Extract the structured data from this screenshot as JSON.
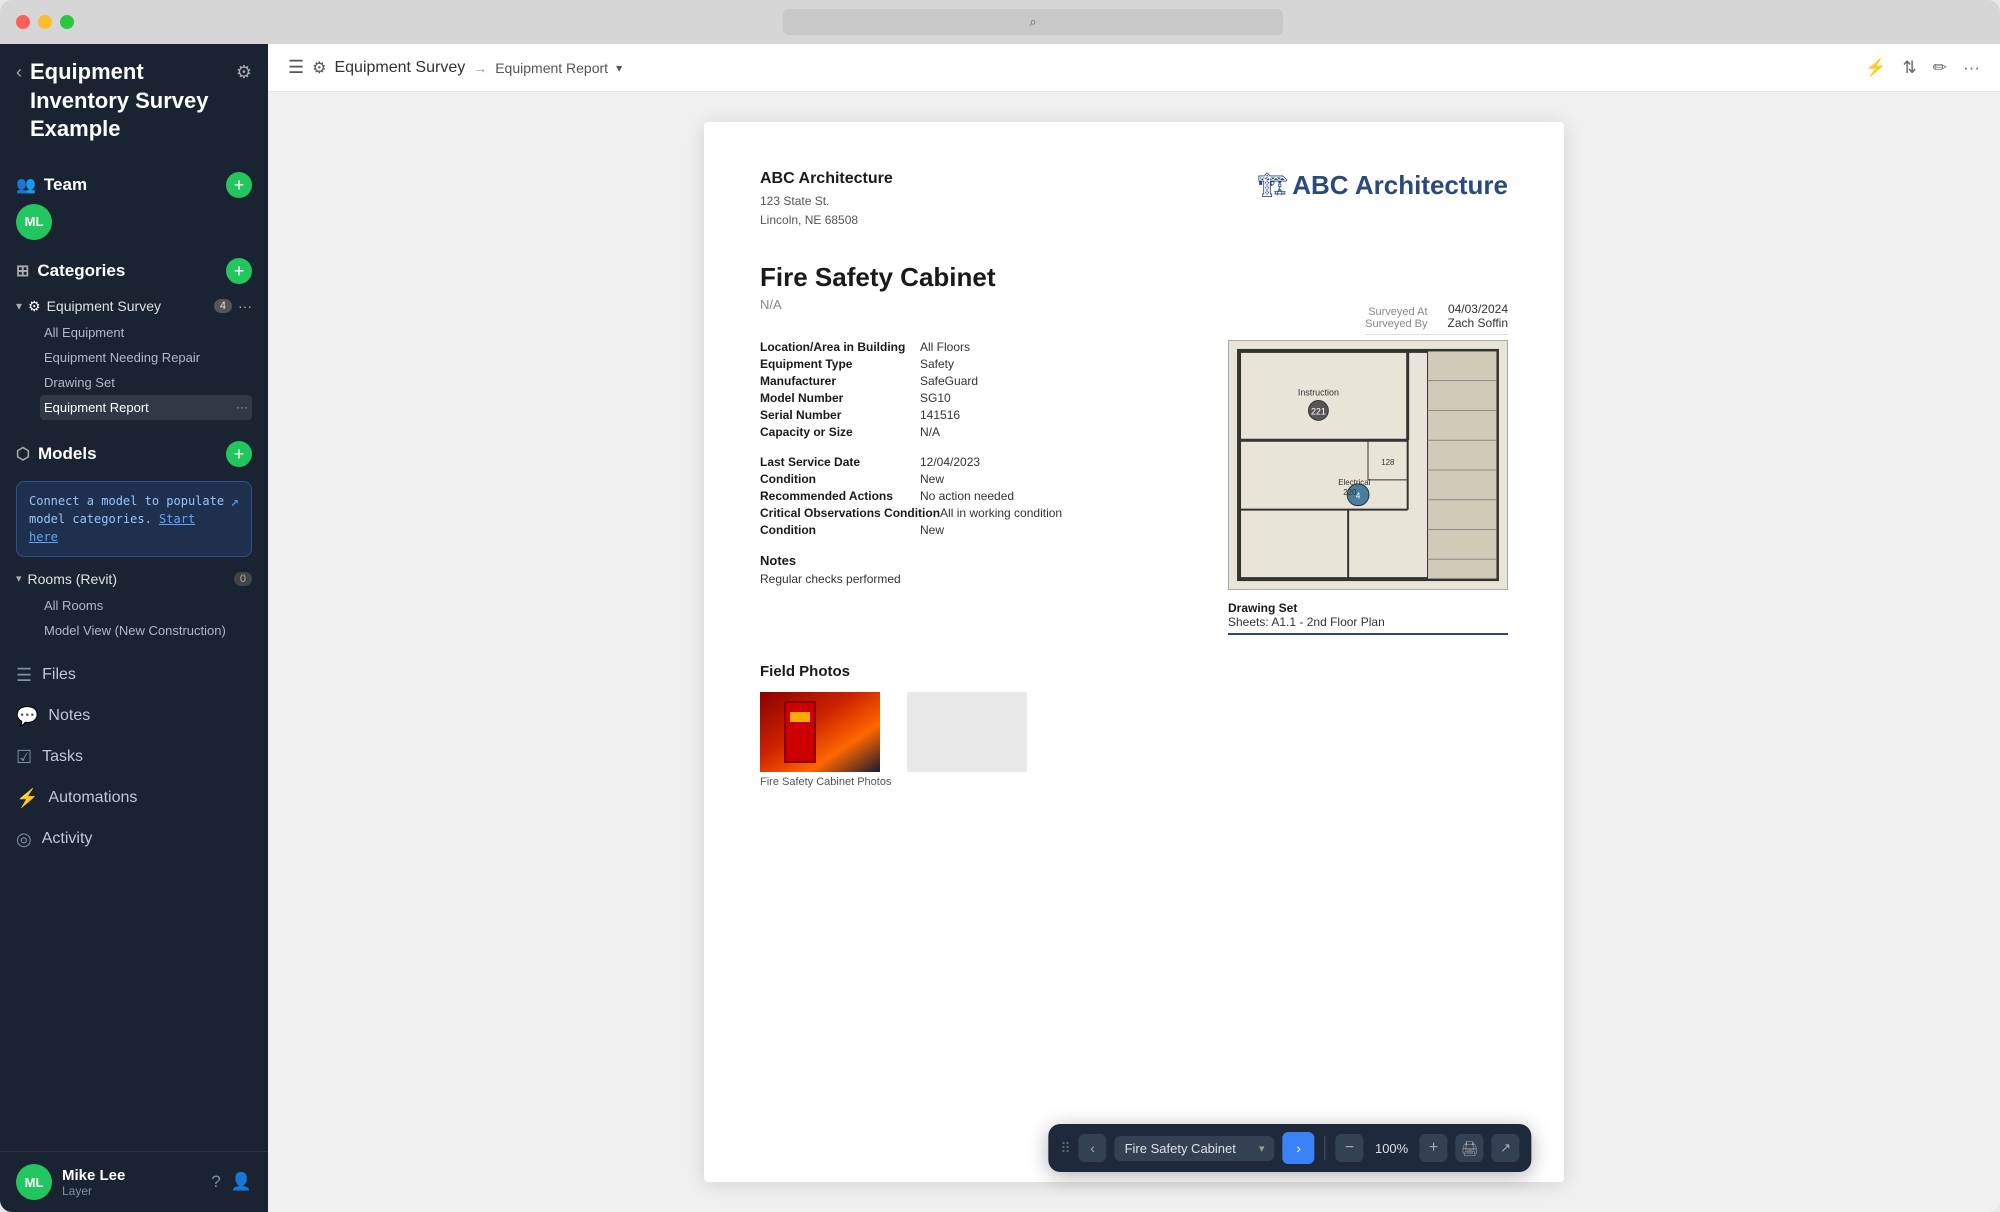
{
  "window": {
    "title": "Equipment Inventory Survey Example"
  },
  "sidebar": {
    "title": "Equipment Inventory Survey Example",
    "team_label": "Team",
    "categories_label": "Categories",
    "models_label": "Models",
    "files_label": "Files",
    "notes_label": "Notes",
    "tasks_label": "Tasks",
    "automations_label": "Automations",
    "activity_label": "Activity",
    "user_name": "Mike Lee",
    "user_role": "Layer",
    "avatar_initials": "ML",
    "models_tip": "Connect a model to populate model categories. Start here",
    "models_tip_link": "Start here",
    "equipment_survey_label": "Equipment Survey",
    "equipment_survey_badge": "4",
    "submenu_all_equipment": "All Equipment",
    "submenu_repair": "Equipment Needing Repair",
    "submenu_drawing_set": "Drawing Set",
    "submenu_report": "Equipment Report",
    "rooms_label": "Rooms (Revit)",
    "rooms_badge": "0",
    "rooms_sub1": "All Rooms",
    "rooms_sub2": "Model View (New Construction)"
  },
  "topbar": {
    "survey_label": "Equipment Survey",
    "arrow": "→",
    "report_label": "Equipment Report",
    "dropdown_caret": "▾"
  },
  "report": {
    "company_name": "ABC Architecture",
    "company_address_line1": "123 State St.",
    "company_address_line2": "Lincoln, NE 68508",
    "logo_text": "ABC Architecture",
    "item_title": "Fire Safety Cabinet",
    "item_na": "N/A",
    "surveyed_at_label": "Surveyed At",
    "surveyed_by_label": "Surveyed By",
    "surveyed_at_value": "04/03/2024",
    "surveyed_by_value": "Zach Soffin",
    "location_label": "Location/Area in Building",
    "location_value": "All Floors",
    "equipment_type_label": "Equipment Type",
    "equipment_type_value": "Safety",
    "manufacturer_label": "Manufacturer",
    "manufacturer_value": "SafeGuard",
    "model_number_label": "Model Number",
    "model_number_value": "SG10",
    "serial_number_label": "Serial Number",
    "serial_number_value": "141516",
    "capacity_label": "Capacity or Size",
    "capacity_value": "N/A",
    "last_service_label": "Last Service Date",
    "last_service_value": "12/04/2023",
    "condition_label": "Condition",
    "condition_value": "New",
    "recommended_actions_label": "Recommended Actions",
    "recommended_actions_value": "No action needed",
    "critical_observations_label": "Critical Observations Condition",
    "critical_observations_value": "All in working condition",
    "condition2_label": "Condition",
    "condition2_value": "New",
    "notes_title": "Notes",
    "notes_value": "Regular checks performed",
    "drawing_set_label": "Drawing Set",
    "drawing_set_sheets": "Sheets: A1.1 - 2nd Floor Plan",
    "field_photos_title": "Field Photos",
    "photo_caption": "Fire Safety Cabinet Photos"
  },
  "toolbar": {
    "item_name": "Fire Safety Cabinet",
    "zoom_level": "100%",
    "drag_icon": "⠿",
    "prev_icon": "‹",
    "next_icon": "›",
    "zoom_out_icon": "−",
    "zoom_in_icon": "+",
    "print_icon": "🖨",
    "external_icon": "↗"
  },
  "colors": {
    "sidebar_bg": "#1a2332",
    "accent_blue": "#3b82f6",
    "accent_green": "#22c55e",
    "logo_blue": "#2a4a7f"
  }
}
